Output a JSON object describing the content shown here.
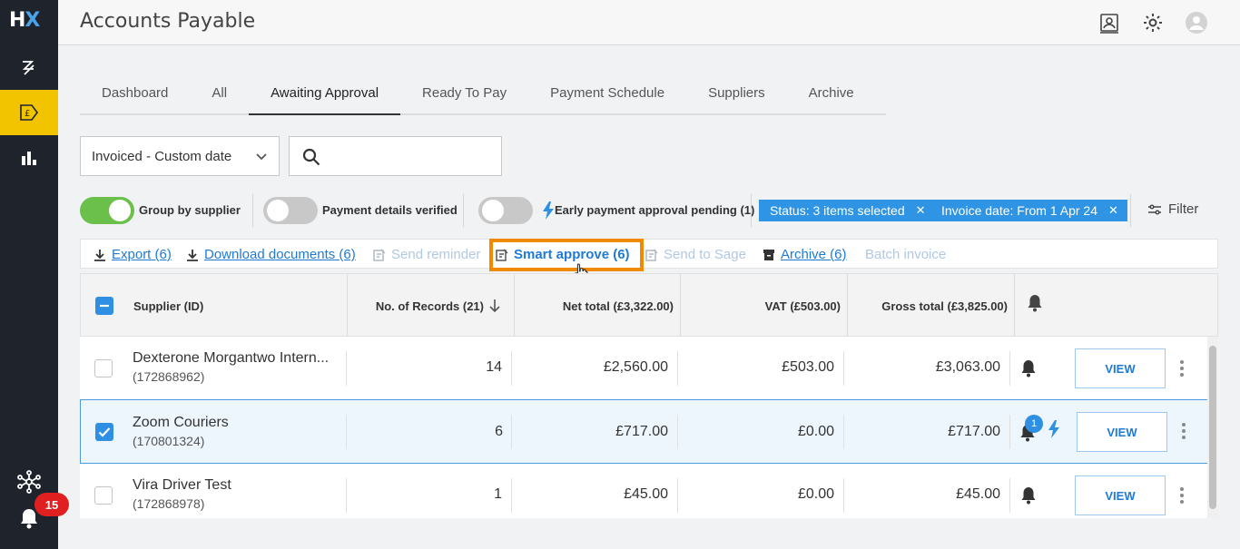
{
  "app": {
    "logo": "HX",
    "title": "Accounts Payable"
  },
  "sidebar": {
    "notifications_count": "15"
  },
  "tabs": [
    "Dashboard",
    "All",
    "Awaiting Approval",
    "Ready To Pay",
    "Payment Schedule",
    "Suppliers",
    "Archive"
  ],
  "active_tab": "Awaiting Approval",
  "filters": {
    "date_select": "Invoiced - Custom date",
    "search_value": "",
    "group_by_supplier": {
      "label": "Group by supplier",
      "on": true
    },
    "payment_verified": {
      "label": "Payment details verified",
      "on": false
    },
    "early_payment": {
      "label": "Early payment approval pending (1)",
      "on": false
    },
    "chips": [
      "Status: 3 items selected",
      "Invoice date: From 1 Apr 24"
    ],
    "filter_label": "Filter"
  },
  "actions": {
    "export": "Export (6)",
    "download": "Download documents (6)",
    "send_reminder": "Send reminder",
    "smart_approve": "Smart approve (6)",
    "send_to_sage": "Send to Sage",
    "archive": "Archive (6)",
    "batch_invoice": "Batch invoice"
  },
  "table": {
    "headers": {
      "supplier": "Supplier (ID)",
      "records": "No. of Records (21)",
      "net": "Net total (£3,322.00)",
      "vat": "VAT (£503.00)",
      "gross": "Gross total (£3,825.00)"
    },
    "view_label": "VIEW",
    "rows": [
      {
        "name": "Dexterone Morgantwo Intern...",
        "id": "(172868962)",
        "records": "14",
        "net": "£2,560.00",
        "vat": "£503.00",
        "gross": "£3,063.00",
        "selected": false
      },
      {
        "name": "Zoom Couriers",
        "id": "(170801324)",
        "records": "6",
        "net": "£717.00",
        "vat": "£0.00",
        "gross": "£717.00",
        "selected": true,
        "bell_count": "1"
      },
      {
        "name": "Vira Driver Test",
        "id": "(172868978)",
        "records": "1",
        "net": "£45.00",
        "vat": "£0.00",
        "gross": "£45.00",
        "selected": false
      }
    ]
  },
  "colors": {
    "accent": "#2e8fe3",
    "nav_active": "#f2c400",
    "highlight": "#f08a00",
    "toggle_on": "#6ac04a"
  }
}
